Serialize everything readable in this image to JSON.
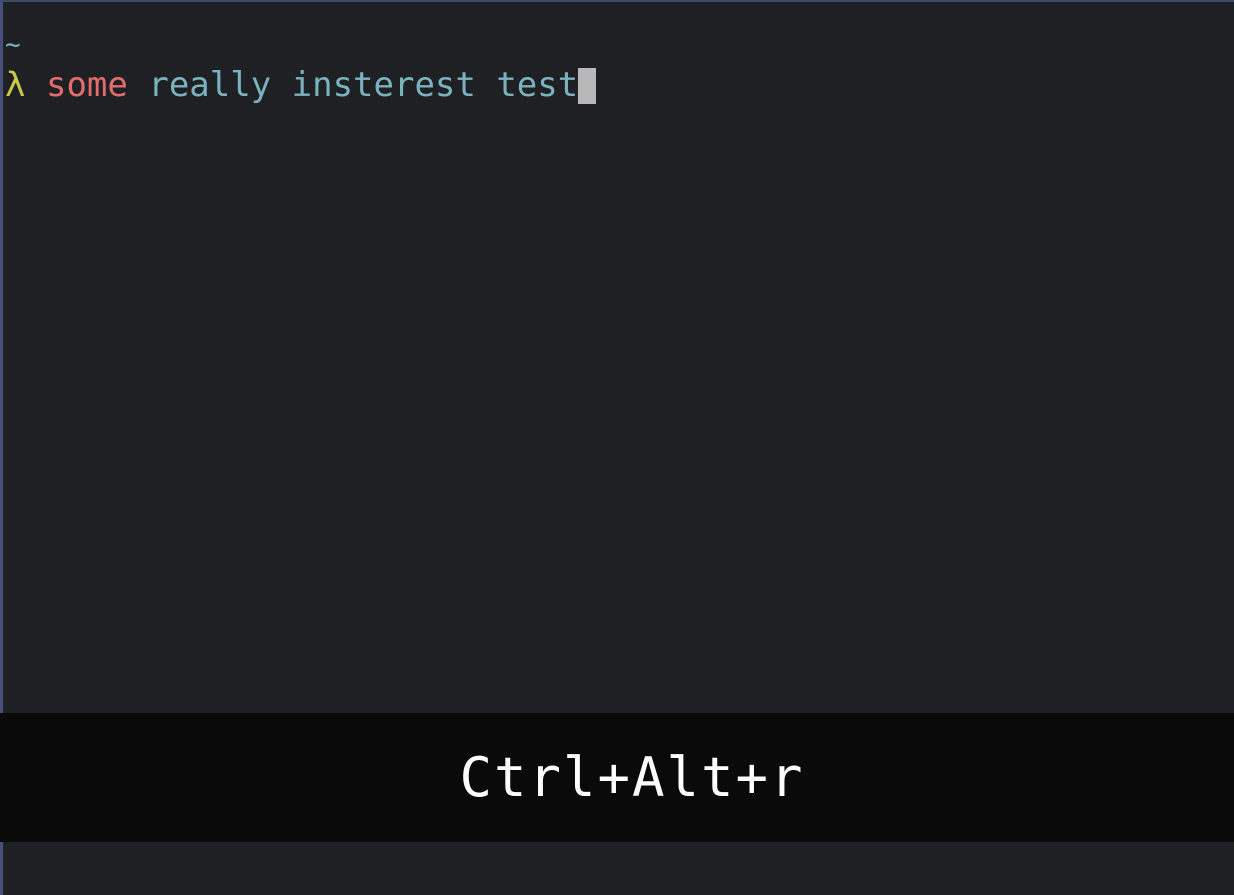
{
  "terminal": {
    "cwd": "~",
    "prompt_symbol": "λ",
    "command": "some",
    "arguments": "really insterest test"
  },
  "keystroke_overlay": {
    "keys": "Ctrl+Alt+r"
  },
  "colors": {
    "background": "#1f2023",
    "prompt_symbol": "#c8c84a",
    "command": "#e36d6d",
    "arguments": "#7ab3bf",
    "cursor": "#b8b8b8",
    "overlay_background": "#0a0a0a",
    "overlay_text": "#ffffff"
  }
}
